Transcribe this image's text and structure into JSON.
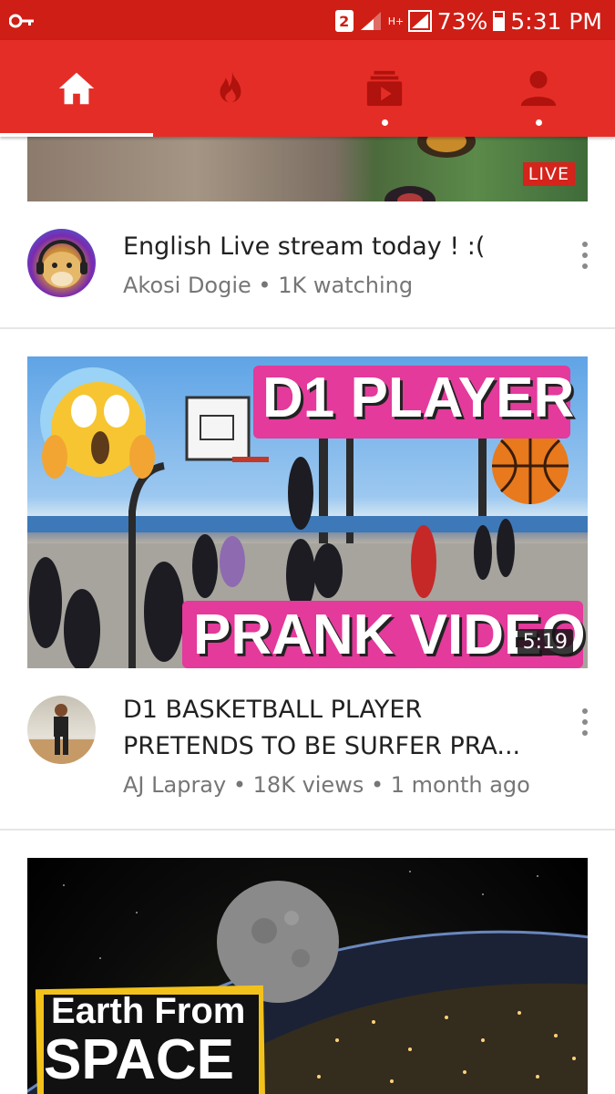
{
  "status_bar": {
    "sim": "2",
    "network": "H+",
    "battery": "73%",
    "time": "5:31 PM"
  },
  "tabs": [
    {
      "name": "home",
      "icon": "home-icon",
      "active": true
    },
    {
      "name": "trending",
      "icon": "fire-icon",
      "active": false
    },
    {
      "name": "subscriptions",
      "icon": "subscriptions-icon",
      "active": false,
      "has_dot": true
    },
    {
      "name": "account",
      "icon": "person-icon",
      "active": false,
      "has_dot": true
    }
  ],
  "videos": [
    {
      "badge": "LIVE",
      "title": "English Live stream today ! :(",
      "channel": "Akosi Dogie",
      "stats": "1K watching"
    },
    {
      "thumbnail_text_top": "D1 PLAYER",
      "thumbnail_text_bottom": "PRANK VIDEO",
      "duration": "5:19",
      "title": "D1 BASKETBALL PLAYER PRETENDS TO BE SURFER PRA...",
      "channel": "AJ Lapray",
      "views": "18K views",
      "age": "1 month ago"
    },
    {
      "thumbnail_text_top": "Earth From",
      "thumbnail_text_bottom": "SPACE"
    }
  ],
  "colors": {
    "status_bar": "#cf1e15",
    "tab_bar": "#e52d27",
    "live_badge": "#d4241b",
    "thumbnail_banner": "#e33a9b"
  }
}
